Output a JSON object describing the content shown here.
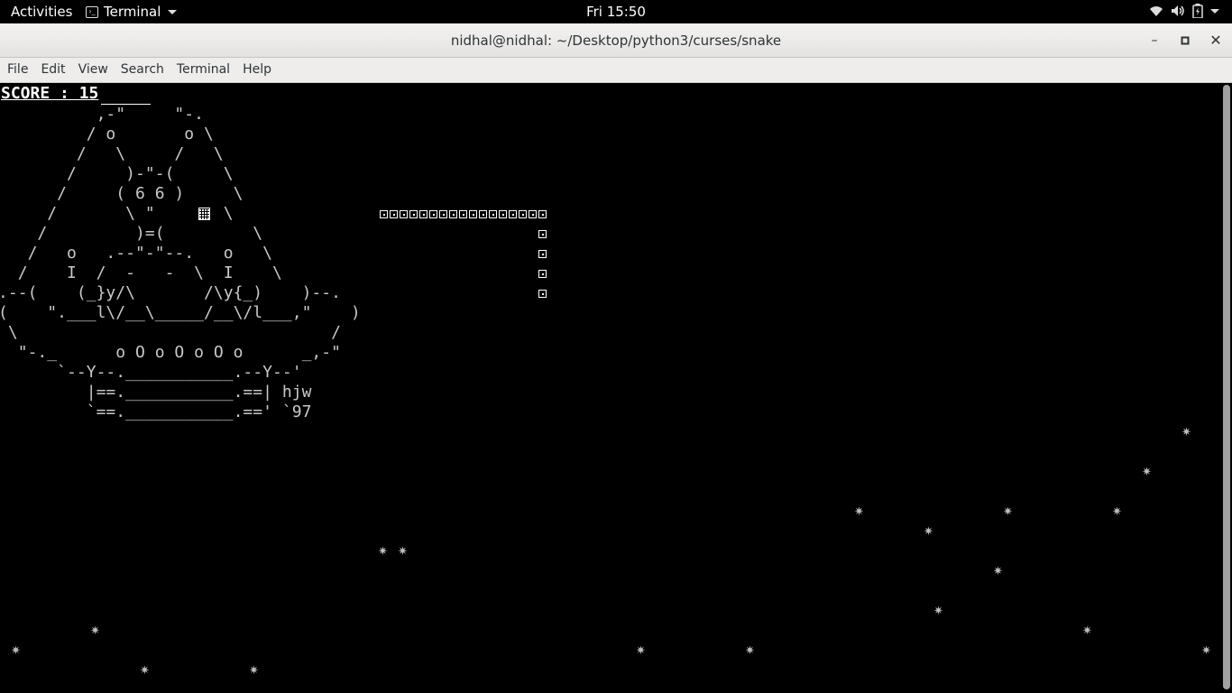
{
  "topbar": {
    "activities": "Activities",
    "app_name": "Terminal",
    "clock": "Fri 15:50",
    "tray_icons": [
      "wifi-icon",
      "volume-icon",
      "battery-icon",
      "system-menu-caret-icon"
    ]
  },
  "window": {
    "title": "nidhal@nidhal: ~/Desktop/python3/curses/snake",
    "minimize": "–",
    "maximize": "▫",
    "close": "✕"
  },
  "menubar": {
    "items": [
      "File",
      "Edit",
      "View",
      "Search",
      "Terminal",
      "Help"
    ]
  },
  "game": {
    "score_text": "SCORE : 15",
    "ascii_art": "          ,-\"     \"-.\n         / o       o \\\n        /   \\     /   \\\n       /     )-\"-(     \\\n      /     ( 6 6 )     \\\n     /       \\ \"       \\\n    /         )=(         \\\n   /   o   .--\"-\"--.   o   \\\n  /    I  /  -   -  \\  I    \\\n.--(    (_}y/\\       /\\y{_)    )--.\n(    \".___l\\/__\\_____/__\\/l___,\"    )\n \\                                /\n  \"-._      o O o O o O o      _,-\"\n      `--Y--.___________.--Y--'\n         |==.___________.==| hjw\n         `==.___________.==' `97",
    "snake_length": 21,
    "colors": {
      "background": "#000000",
      "text": "#c9c9c9",
      "snake": "#ffffff",
      "stars": "#bdbdbd"
    }
  }
}
